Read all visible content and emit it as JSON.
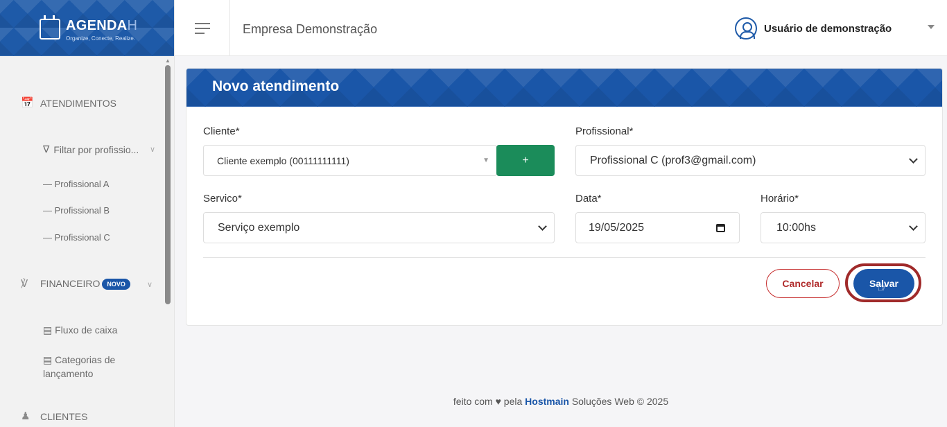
{
  "brand": {
    "name": "AGENDA",
    "name_suffix": "H",
    "tagline": "Organize, Conecte, Realize."
  },
  "header": {
    "company": "Empresa Demonstração",
    "user": "Usuário de demonstração"
  },
  "sidebar": {
    "atendimentos": "ATENDIMENTOS",
    "filter": "Filtar por profissio...",
    "professionals": [
      "Profissional A",
      "Profissional B",
      "Profissional C"
    ],
    "financeiro": "FINANCEIRO",
    "novo_badge": "NOVO",
    "fluxo": "Fluxo de caixa",
    "categorias": "Categorias de lançamento",
    "clientes": "CLIENTES"
  },
  "form": {
    "title": "Novo atendimento",
    "cliente_label": "Cliente*",
    "cliente_value": "Cliente exemplo (00111111111)",
    "add_label": "+",
    "profissional_label": "Profissional*",
    "profissional_value": "Profissional C (prof3@gmail.com)",
    "servico_label": "Servico*",
    "servico_value": "Serviço exemplo",
    "data_label": "Data*",
    "data_value": "19/05/2025",
    "horario_label": "Horário*",
    "horario_value": "10:00hs",
    "cancel_label": "Cancelar",
    "save_label": "Salvar"
  },
  "footer": {
    "prefix": "feito com",
    "middle": "pela",
    "company": "Hostmain",
    "suffix": "Soluções Web © 2025"
  },
  "colors": {
    "primary": "#1a56a8",
    "success": "#1b8c5a",
    "danger": "#c62e2e",
    "highlight": "#a02a2a"
  }
}
